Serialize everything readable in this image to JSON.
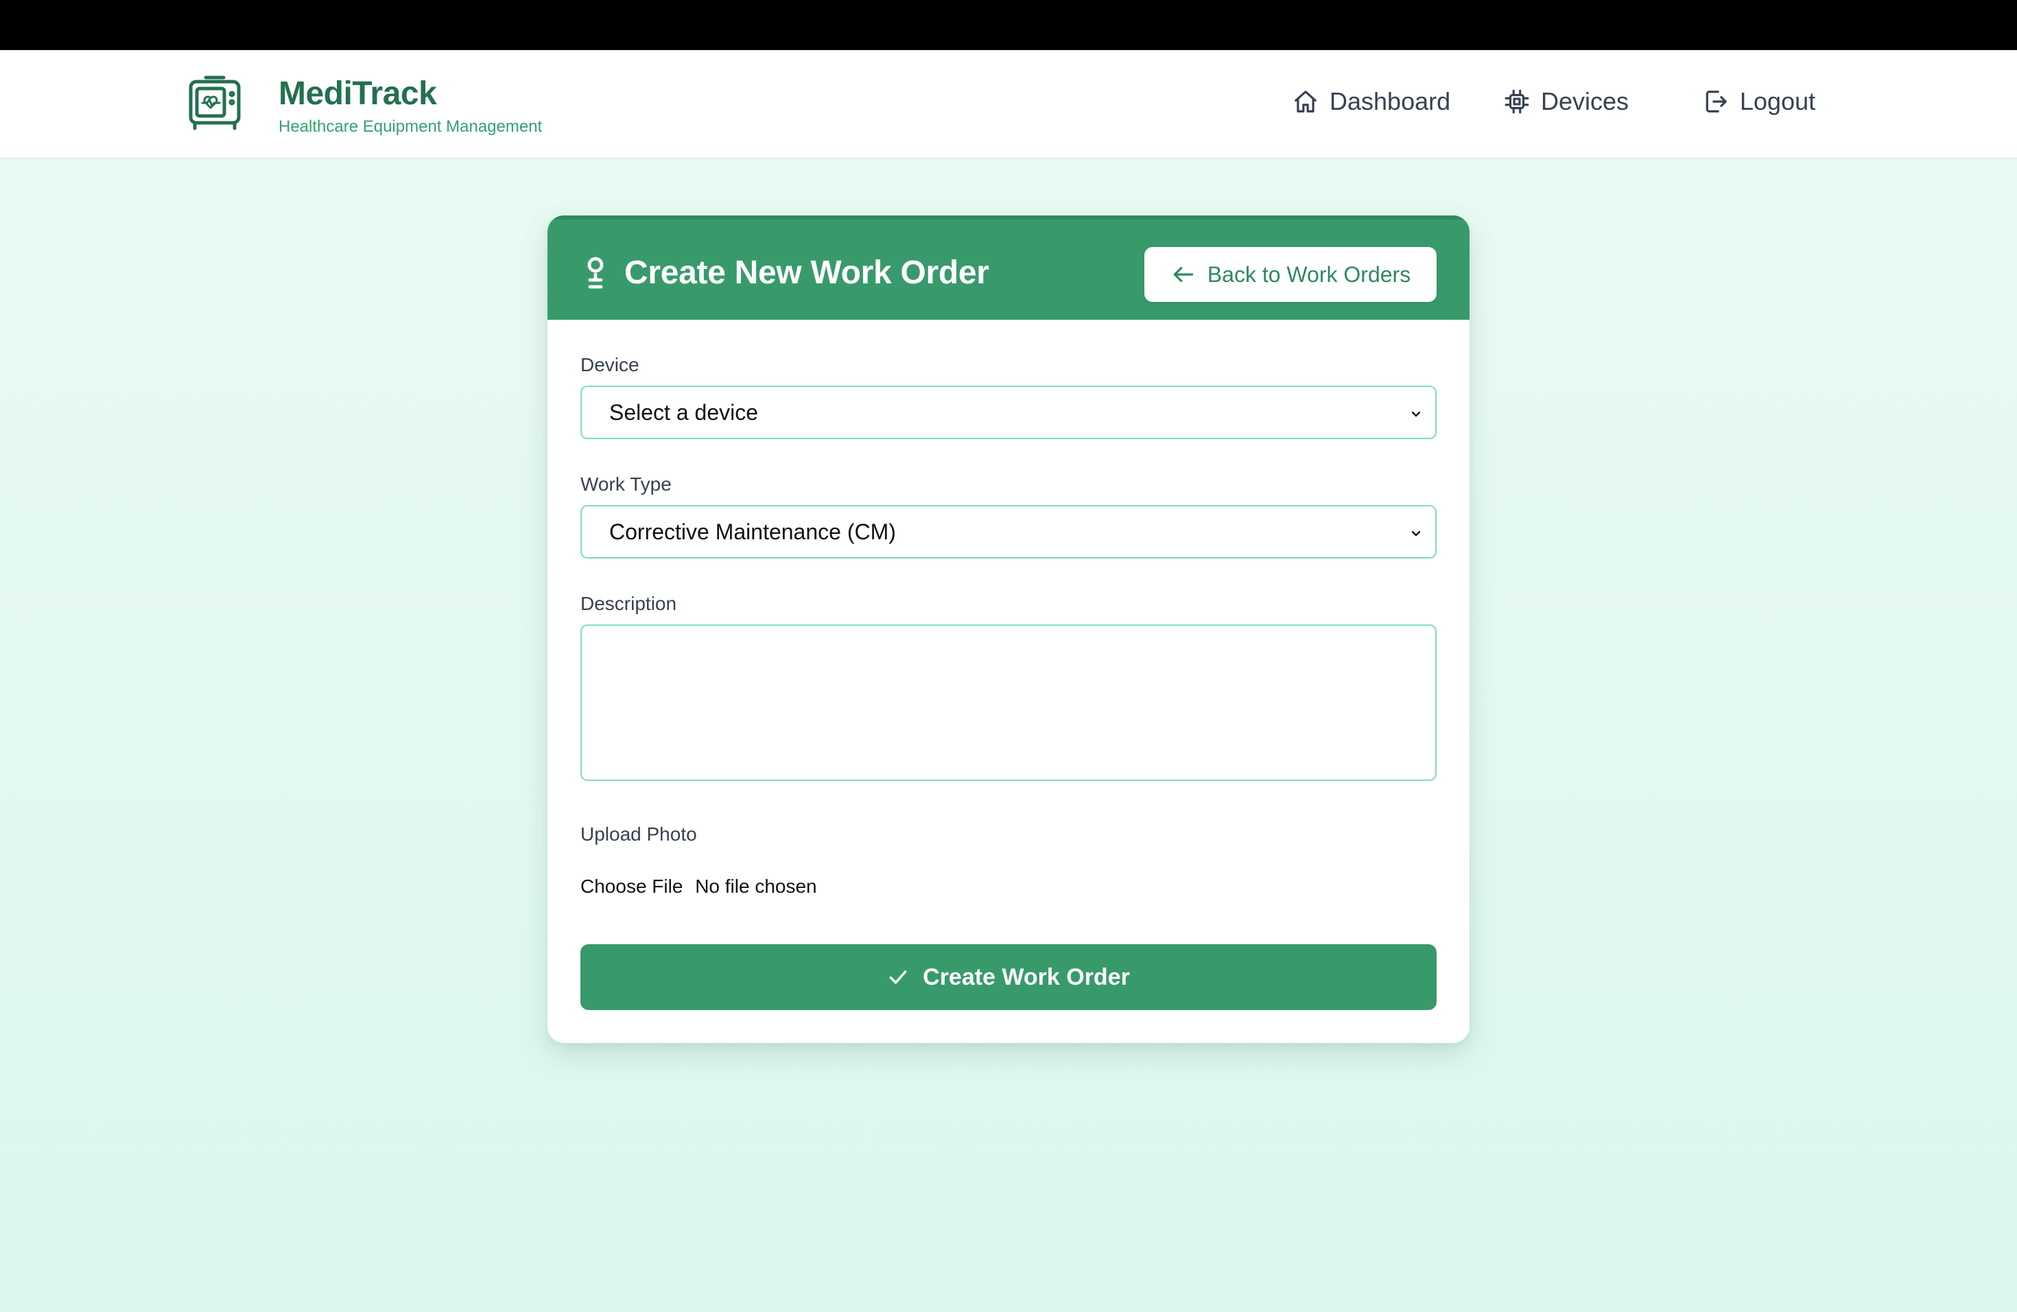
{
  "colors": {
    "brand": "#23704f",
    "accent": "#389a6b",
    "input_border": "#7fdcbc",
    "background": "#e3f9f1"
  },
  "brand": {
    "title": "MediTrack",
    "subtitle": "Healthcare Equipment Management",
    "logo_icon": "medical-monitor-icon"
  },
  "nav": {
    "items": [
      {
        "label": "Dashboard",
        "icon": "home-icon"
      },
      {
        "label": "Devices",
        "icon": "chip-icon"
      },
      {
        "label": "Logout",
        "icon": "logout-icon"
      }
    ]
  },
  "form": {
    "title": "Create New Work Order",
    "title_icon": "wrench-icon",
    "back_label": "Back to Work Orders",
    "device_label": "Device",
    "device_value": "Select a device",
    "work_type_label": "Work Type",
    "work_type_value": "Corrective Maintenance (CM)",
    "description_label": "Description",
    "description_value": "",
    "upload_label": "Upload Photo",
    "file_button": "Choose File",
    "file_status": "No file chosen",
    "submit_label": "Create Work Order"
  }
}
